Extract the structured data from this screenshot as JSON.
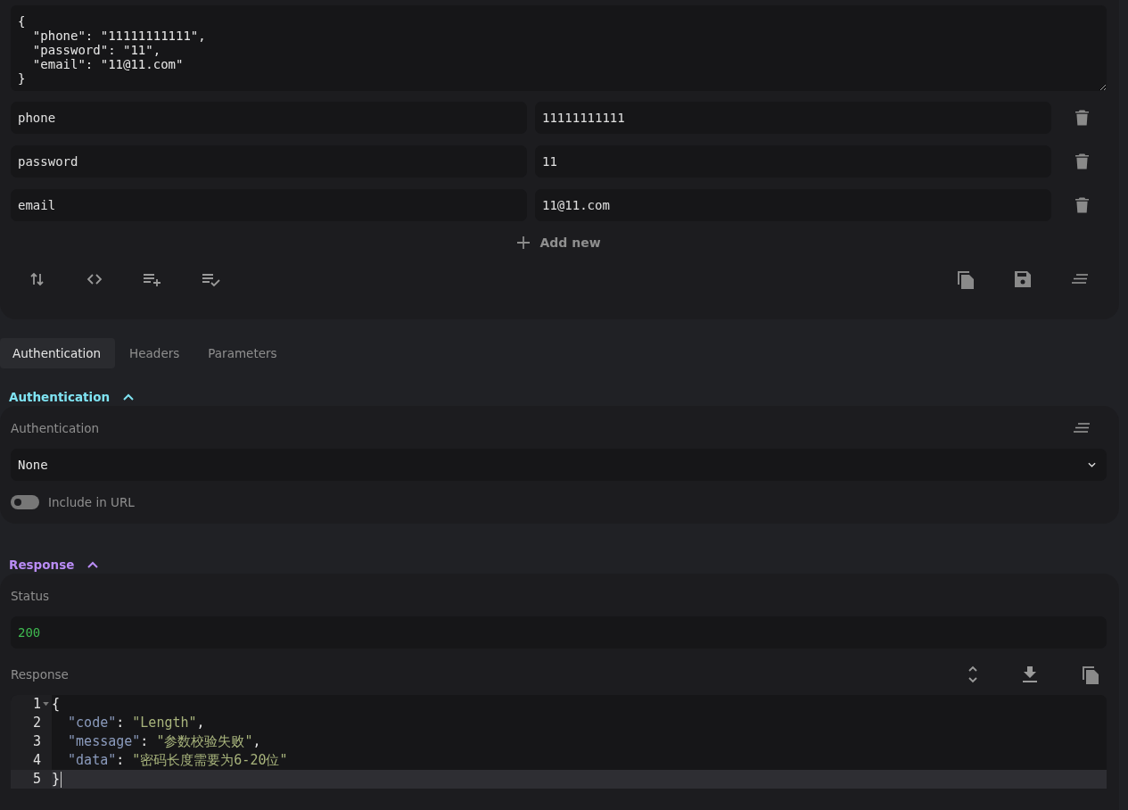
{
  "body_editor": {
    "text": "{\n  \"phone\": \"11111111111\",\n  \"password\": \"11\",\n  \"email\": \"11@11.com\"\n}"
  },
  "fields": [
    {
      "key": "phone",
      "value": "11111111111"
    },
    {
      "key": "password",
      "value": "11"
    },
    {
      "key": "email",
      "value": "11@11.com"
    }
  ],
  "add_button": "Add new",
  "tabs": [
    {
      "label": "Authentication",
      "selected": true
    },
    {
      "label": "Headers",
      "selected": false
    },
    {
      "label": "Parameters",
      "selected": false
    }
  ],
  "auth_section": {
    "title": "Authentication",
    "expanded": true,
    "label": "Authentication",
    "select_value": "None",
    "include_in_url": {
      "label": "Include in URL",
      "on": false
    }
  },
  "response_section": {
    "title": "Response",
    "expanded": true,
    "status_label": "Status",
    "status": "200",
    "response_label": "Response",
    "code_lines": [
      {
        "number": "1",
        "foldable": true,
        "active": false,
        "kind": "brace",
        "tokens": [
          {
            "kind": "punct",
            "text": "{"
          }
        ]
      },
      {
        "number": "2",
        "foldable": false,
        "active": false,
        "kind": "member",
        "tokens": [
          {
            "kind": "key",
            "text": "\"code\""
          },
          {
            "kind": "punct",
            "text": ": "
          },
          {
            "kind": "string",
            "text": "\"Length\""
          },
          {
            "kind": "punct",
            "text": ","
          }
        ]
      },
      {
        "number": "3",
        "foldable": false,
        "active": false,
        "kind": "member",
        "tokens": [
          {
            "kind": "key",
            "text": "\"message\""
          },
          {
            "kind": "punct",
            "text": ": "
          },
          {
            "kind": "string",
            "text": "\"参数校验失败\""
          },
          {
            "kind": "punct",
            "text": ","
          }
        ]
      },
      {
        "number": "4",
        "foldable": false,
        "active": false,
        "kind": "member",
        "tokens": [
          {
            "kind": "key",
            "text": "\"data\""
          },
          {
            "kind": "punct",
            "text": ": "
          },
          {
            "kind": "string",
            "text": "\"密码长度需要为6-20位\""
          }
        ]
      },
      {
        "number": "5",
        "foldable": false,
        "active": true,
        "kind": "brace",
        "tokens": [
          {
            "kind": "punct",
            "text": "}"
          }
        ]
      }
    ]
  }
}
